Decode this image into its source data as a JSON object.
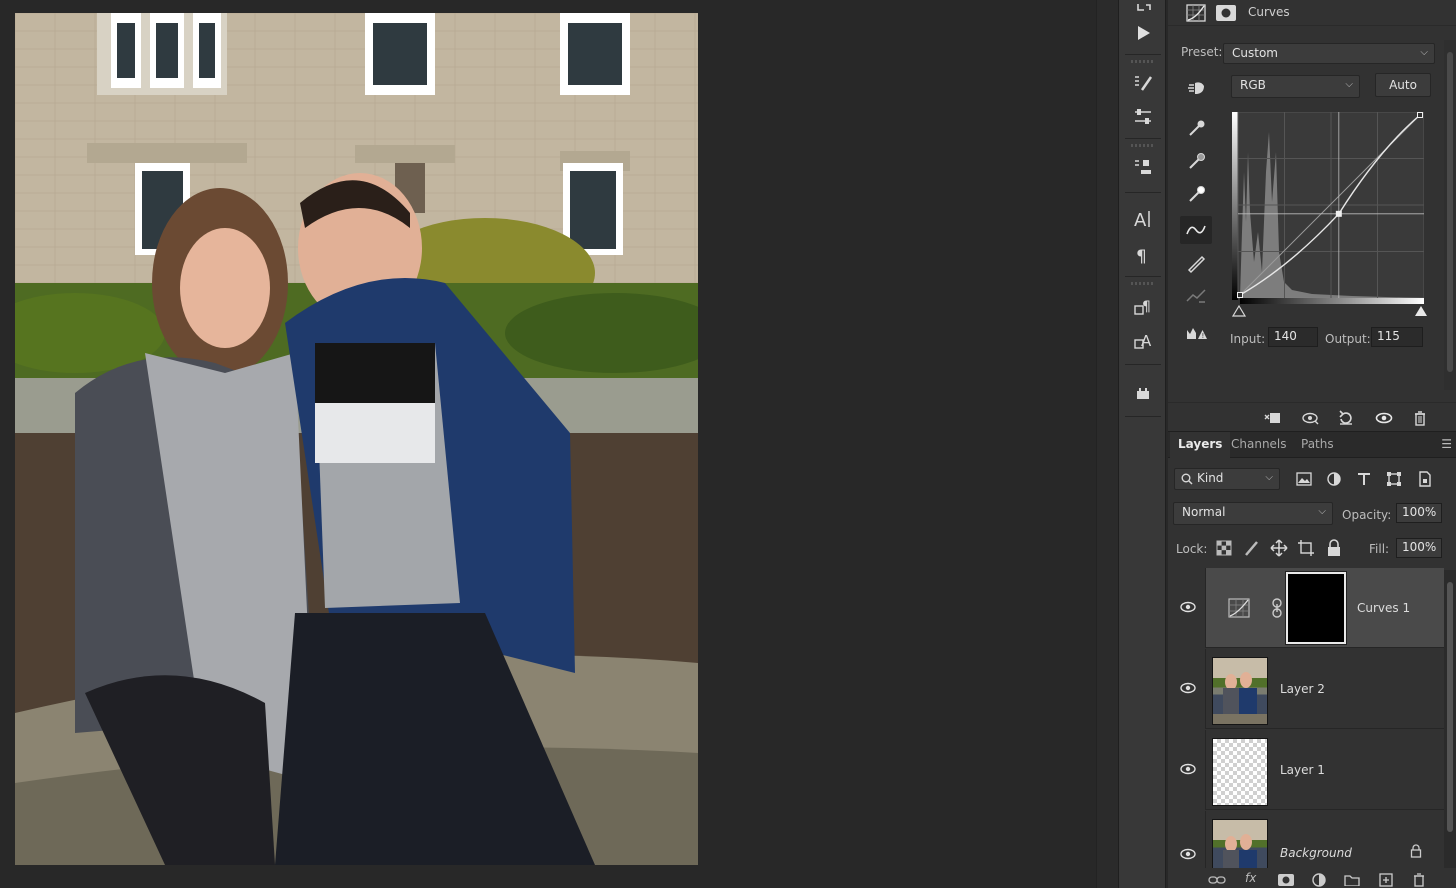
{
  "properties": {
    "title": "Curves",
    "preset_label": "Preset:",
    "preset_value": "Custom",
    "channel_value": "RGB",
    "auto_label": "Auto",
    "input_label": "Input:",
    "input_value": "140",
    "output_label": "Output:",
    "output_value": "115"
  },
  "curve": {
    "points": [
      [
        0,
        0
      ],
      [
        140,
        115
      ],
      [
        255,
        255
      ]
    ]
  },
  "layers_panel": {
    "tabs": [
      "Layers",
      "Channels",
      "Paths"
    ],
    "kind_label": "Kind",
    "blend_mode": "Normal",
    "opacity_label": "Opacity:",
    "opacity_value": "100%",
    "lock_label": "Lock:",
    "fill_label": "Fill:",
    "fill_value": "100%",
    "layers": [
      {
        "name": "Curves 1",
        "selected": true
      },
      {
        "name": "Layer 2",
        "selected": false
      },
      {
        "name": "Layer 1",
        "selected": false
      },
      {
        "name": "Background",
        "selected": false,
        "locked": true
      }
    ]
  },
  "colors": {
    "panel": "#323232",
    "selected_row": "#4a4a4a",
    "canvas": "#282828"
  }
}
